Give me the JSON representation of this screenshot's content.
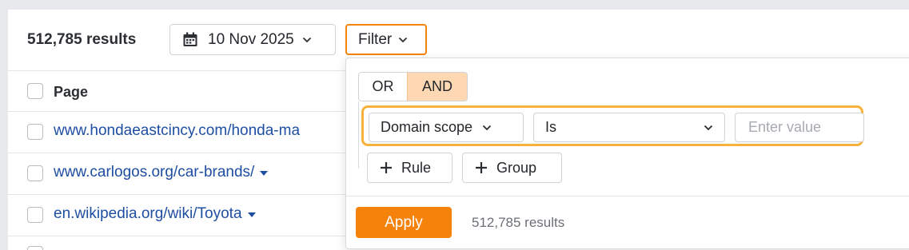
{
  "toolbar": {
    "results_count": "512,785 results",
    "date_label": "10 Nov 2025",
    "filter_label": "Filter"
  },
  "table": {
    "column_page": "Page",
    "rows": [
      {
        "url": "www.hondaeastcincy.com/honda-ma"
      },
      {
        "url": "www.carlogos.org/car-brands/"
      },
      {
        "url": "en.wikipedia.org/wiki/Toyota"
      }
    ]
  },
  "filter_panel": {
    "logic_or": "OR",
    "logic_and": "AND",
    "selected_logic": "AND",
    "rule": {
      "field": "Domain scope",
      "operator": "Is",
      "value_placeholder": "Enter value"
    },
    "add_rule_label": "Rule",
    "add_group_label": "Group",
    "apply_label": "Apply",
    "results_count": "512,785 results"
  },
  "colors": {
    "accent": "#f5820b",
    "highlight": "#f7b23b",
    "and_selected_bg": "#fdd8b2",
    "link": "#1e4ea1"
  },
  "icons": [
    "calendar-icon",
    "chevron-down-icon",
    "caret-down-icon",
    "plus-icon"
  ]
}
